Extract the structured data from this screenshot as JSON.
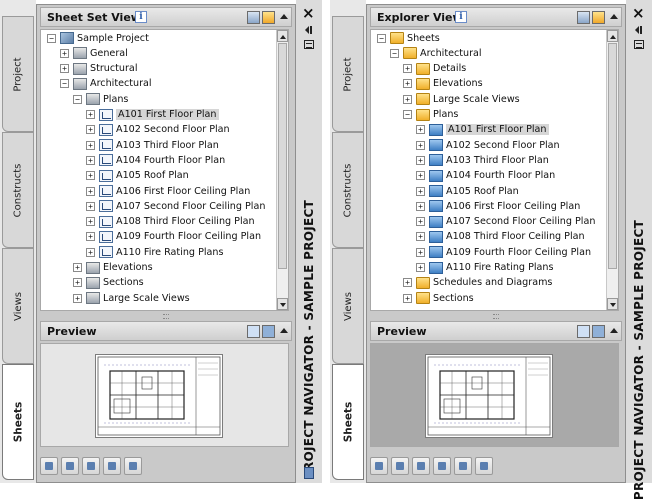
{
  "left_palette": {
    "tabs": [
      "Project",
      "Constructs",
      "Views",
      "Sheets"
    ],
    "header_title": "Sheet Set View",
    "info_label": "i",
    "preview_title": "Preview",
    "palette_title": "PROJECT NAVIGATOR - SAMPLE PROJECT",
    "close_label": "×",
    "tree": [
      {
        "label": "Sample Project",
        "level": 0,
        "toggle": "−",
        "icon": "set"
      },
      {
        "label": "General",
        "level": 1,
        "toggle": "+",
        "icon": "subset"
      },
      {
        "label": "Structural",
        "level": 1,
        "toggle": "+",
        "icon": "subset"
      },
      {
        "label": "Architectural",
        "level": 1,
        "toggle": "−",
        "icon": "subset"
      },
      {
        "label": "Plans",
        "level": 2,
        "toggle": "−",
        "icon": "subset"
      },
      {
        "label": "A101 First Floor Plan",
        "level": 3,
        "toggle": "+",
        "icon": "sheet",
        "selected": true
      },
      {
        "label": "A102 Second Floor Plan",
        "level": 3,
        "toggle": "+",
        "icon": "sheet"
      },
      {
        "label": "A103 Third Floor Plan",
        "level": 3,
        "toggle": "+",
        "icon": "sheet"
      },
      {
        "label": "A104 Fourth Floor Plan",
        "level": 3,
        "toggle": "+",
        "icon": "sheet"
      },
      {
        "label": "A105 Roof Plan",
        "level": 3,
        "toggle": "+",
        "icon": "sheet"
      },
      {
        "label": "A106 First Floor Ceiling Plan",
        "level": 3,
        "toggle": "+",
        "icon": "sheet"
      },
      {
        "label": "A107 Second Floor Ceiling Plan",
        "level": 3,
        "toggle": "+",
        "icon": "sheet"
      },
      {
        "label": "A108 Third Floor Ceiling Plan",
        "level": 3,
        "toggle": "+",
        "icon": "sheet"
      },
      {
        "label": "A109 Fourth Floor Ceiling Plan",
        "level": 3,
        "toggle": "+",
        "icon": "sheet"
      },
      {
        "label": "A110 Fire Rating Plans",
        "level": 3,
        "toggle": "+",
        "icon": "sheet"
      },
      {
        "label": "Elevations",
        "level": 2,
        "toggle": "+",
        "icon": "subset"
      },
      {
        "label": "Sections",
        "level": 2,
        "toggle": "+",
        "icon": "subset"
      },
      {
        "label": "Large Scale Views",
        "level": 2,
        "toggle": "+",
        "icon": "subset"
      }
    ],
    "toolbar_icons": [
      "sheet-set-properties-icon",
      "new-sheet-icon",
      "publish-icon",
      "sheet-list-table-icon",
      "refresh-icon"
    ]
  },
  "right_palette": {
    "tabs": [
      "Project",
      "Constructs",
      "Views",
      "Sheets"
    ],
    "header_title": "Explorer View",
    "info_label": "i",
    "preview_title": "Preview",
    "palette_title": "PROJECT NAVIGATOR - SAMPLE PROJECT",
    "close_label": "×",
    "tree": [
      {
        "label": "Sheets",
        "level": 0,
        "toggle": "−",
        "icon": "folder"
      },
      {
        "label": "Architectural",
        "level": 1,
        "toggle": "−",
        "icon": "folder"
      },
      {
        "label": "Details",
        "level": 2,
        "toggle": "+",
        "icon": "folder"
      },
      {
        "label": "Elevations",
        "level": 2,
        "toggle": "+",
        "icon": "folder"
      },
      {
        "label": "Large Scale Views",
        "level": 2,
        "toggle": "+",
        "icon": "folder"
      },
      {
        "label": "Plans",
        "level": 2,
        "toggle": "−",
        "icon": "folder"
      },
      {
        "label": "A101 First Floor Plan",
        "level": 3,
        "toggle": "+",
        "icon": "esheet",
        "selected": true
      },
      {
        "label": "A102 Second Floor Plan",
        "level": 3,
        "toggle": "+",
        "icon": "esheet"
      },
      {
        "label": "A103 Third Floor Plan",
        "level": 3,
        "toggle": "+",
        "icon": "esheet"
      },
      {
        "label": "A104 Fourth Floor Plan",
        "level": 3,
        "toggle": "+",
        "icon": "esheet"
      },
      {
        "label": "A105 Roof Plan",
        "level": 3,
        "toggle": "+",
        "icon": "esheet"
      },
      {
        "label": "A106 First Floor Ceiling Plan",
        "level": 3,
        "toggle": "+",
        "icon": "esheet"
      },
      {
        "label": "A107 Second Floor Ceiling Plan",
        "level": 3,
        "toggle": "+",
        "icon": "esheet"
      },
      {
        "label": "A108 Third Floor Ceiling Plan",
        "level": 3,
        "toggle": "+",
        "icon": "esheet"
      },
      {
        "label": "A109 Fourth Floor Ceiling Plan",
        "level": 3,
        "toggle": "+",
        "icon": "esheet"
      },
      {
        "label": "A110 Fire Rating Plans",
        "level": 3,
        "toggle": "+",
        "icon": "esheet"
      },
      {
        "label": "Schedules and Diagrams",
        "level": 2,
        "toggle": "+",
        "icon": "folder"
      },
      {
        "label": "Sections",
        "level": 2,
        "toggle": "+",
        "icon": "folder"
      }
    ],
    "toolbar_icons": [
      "sheet-set-properties-icon",
      "repath-icon",
      "publish-icon",
      "sheet-list-table-icon",
      "refresh-icon",
      "archive-icon"
    ]
  }
}
